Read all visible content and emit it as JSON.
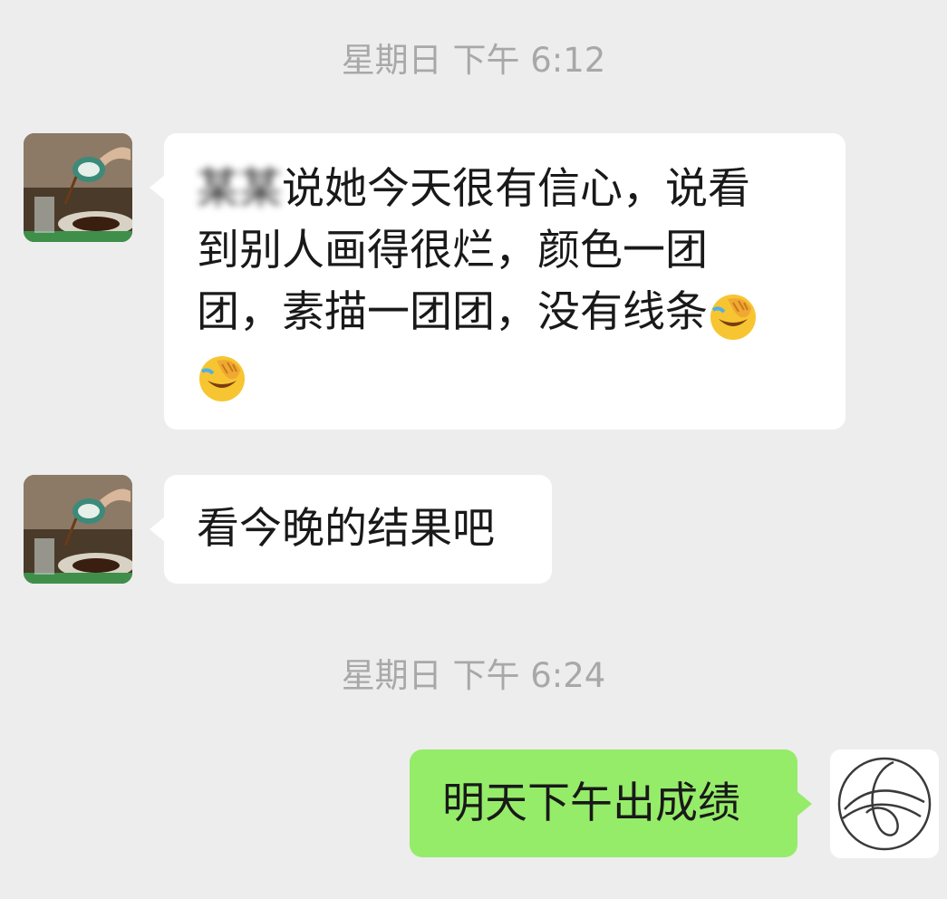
{
  "timestamps": [
    "星期日 下午 6:12",
    "星期日 下午 6:24"
  ],
  "messages": [
    {
      "sender": "other",
      "redacted_name": "某某",
      "text_line1": "说她今天很有信心，说看",
      "text_line2": "到别人画得很烂，颜色一团",
      "text_line3": "团，素描一团团，没有线条",
      "emojis": [
        "facepalm-laugh-emoji",
        "facepalm-laugh-emoji"
      ]
    },
    {
      "sender": "other",
      "text": "看今晚的结果吧"
    },
    {
      "sender": "me",
      "text": "明天下午出成绩"
    }
  ],
  "colors": {
    "background": "#ededed",
    "bubble_incoming": "#ffffff",
    "bubble_outgoing": "#95ec69",
    "timestamp": "#a8a8a8",
    "text": "#191919"
  }
}
